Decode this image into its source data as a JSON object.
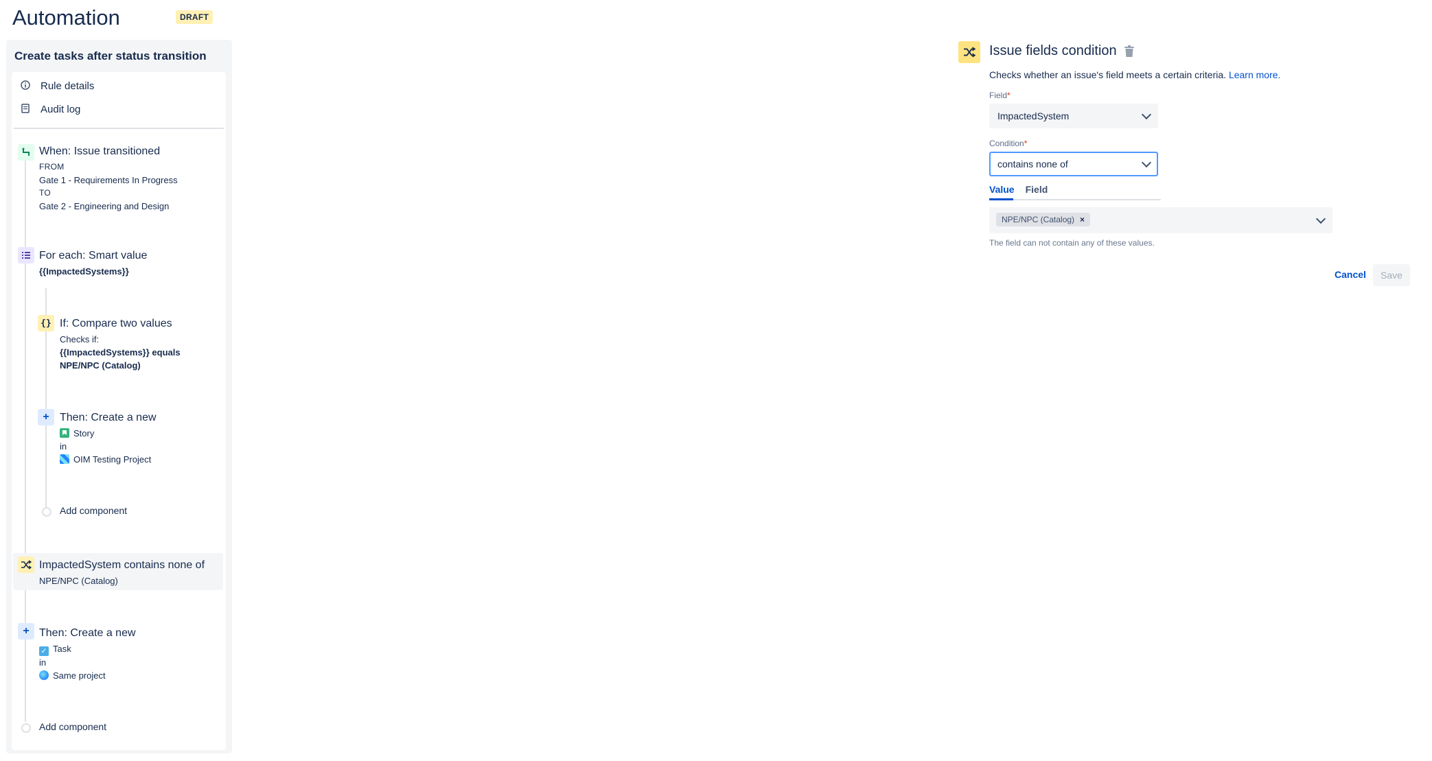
{
  "app": {
    "title": "Automation",
    "badge": "DRAFT"
  },
  "rule": {
    "name": "Create tasks after status transition"
  },
  "nav": [
    {
      "label": "Rule details",
      "icon": "info-icon"
    },
    {
      "label": "Audit log",
      "icon": "document-icon"
    }
  ],
  "trigger": {
    "title": "When: Issue transitioned",
    "from_label": "FROM",
    "from_value": "Gate 1 - Requirements In Progress",
    "to_label": "TO",
    "to_value": "Gate 2 - Engineering and Design",
    "icon": "transition-icon"
  },
  "foreach": {
    "title": "For each: Smart value",
    "value": "{{ImpactedSystems}}",
    "icon": "list-icon"
  },
  "if_block": {
    "title": "If: Compare two values",
    "checks": "Checks if:",
    "expr_line1": "{{ImpactedSystems}} equals",
    "expr_line2": "NPE/NPC (Catalog)",
    "icon": "curly-braces-icon"
  },
  "then_story": {
    "title": "Then: Create a new",
    "type": "Story",
    "in": "in",
    "project": "OIM Testing Project",
    "icon": "plus-icon"
  },
  "add_component_inner": "Add component",
  "condition_block": {
    "title": "ImpactedSystem contains none of",
    "value": "NPE/NPC (Catalog)",
    "icon": "shuffle-icon"
  },
  "then_task": {
    "title": "Then: Create a new",
    "type": "Task",
    "in": "in",
    "project": "Same project",
    "icon": "plus-icon"
  },
  "add_component_outer": "Add component",
  "panel": {
    "title": "Issue fields condition",
    "description": "Checks whether an issue's field meets a certain criteria.",
    "learn_more": "Learn more.",
    "field_label": "Field",
    "field_value": "ImpactedSystem",
    "condition_label": "Condition",
    "condition_value": "contains none of",
    "required_mark": "*",
    "tabs": [
      "Value",
      "Field"
    ],
    "chips": [
      "NPE/NPC (Catalog)"
    ],
    "chip_remove": "×",
    "helper": "The field can not contain any of these values.",
    "cancel": "Cancel",
    "save": "Save"
  },
  "colors": {
    "accent": "#0052cc",
    "draft_badge": "#fff0b3",
    "condition_icon_bg": "#ffe380",
    "focus_border": "#4c9aff"
  }
}
